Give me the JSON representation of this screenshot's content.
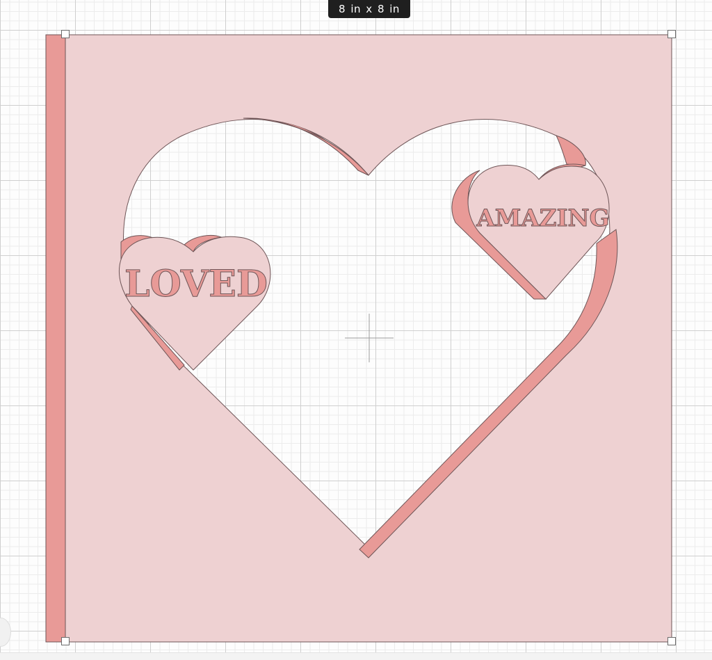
{
  "canvas": {
    "size_label": "8  in x 8  in"
  },
  "design": {
    "small_heart_left_text": "LOVED",
    "small_heart_right_text": "AMAZING"
  },
  "colors": {
    "card_light": "#eed1d2",
    "card_shadow": "#e89a97",
    "outline": "#6e5557",
    "badge_bg": "#1f1f1f"
  }
}
